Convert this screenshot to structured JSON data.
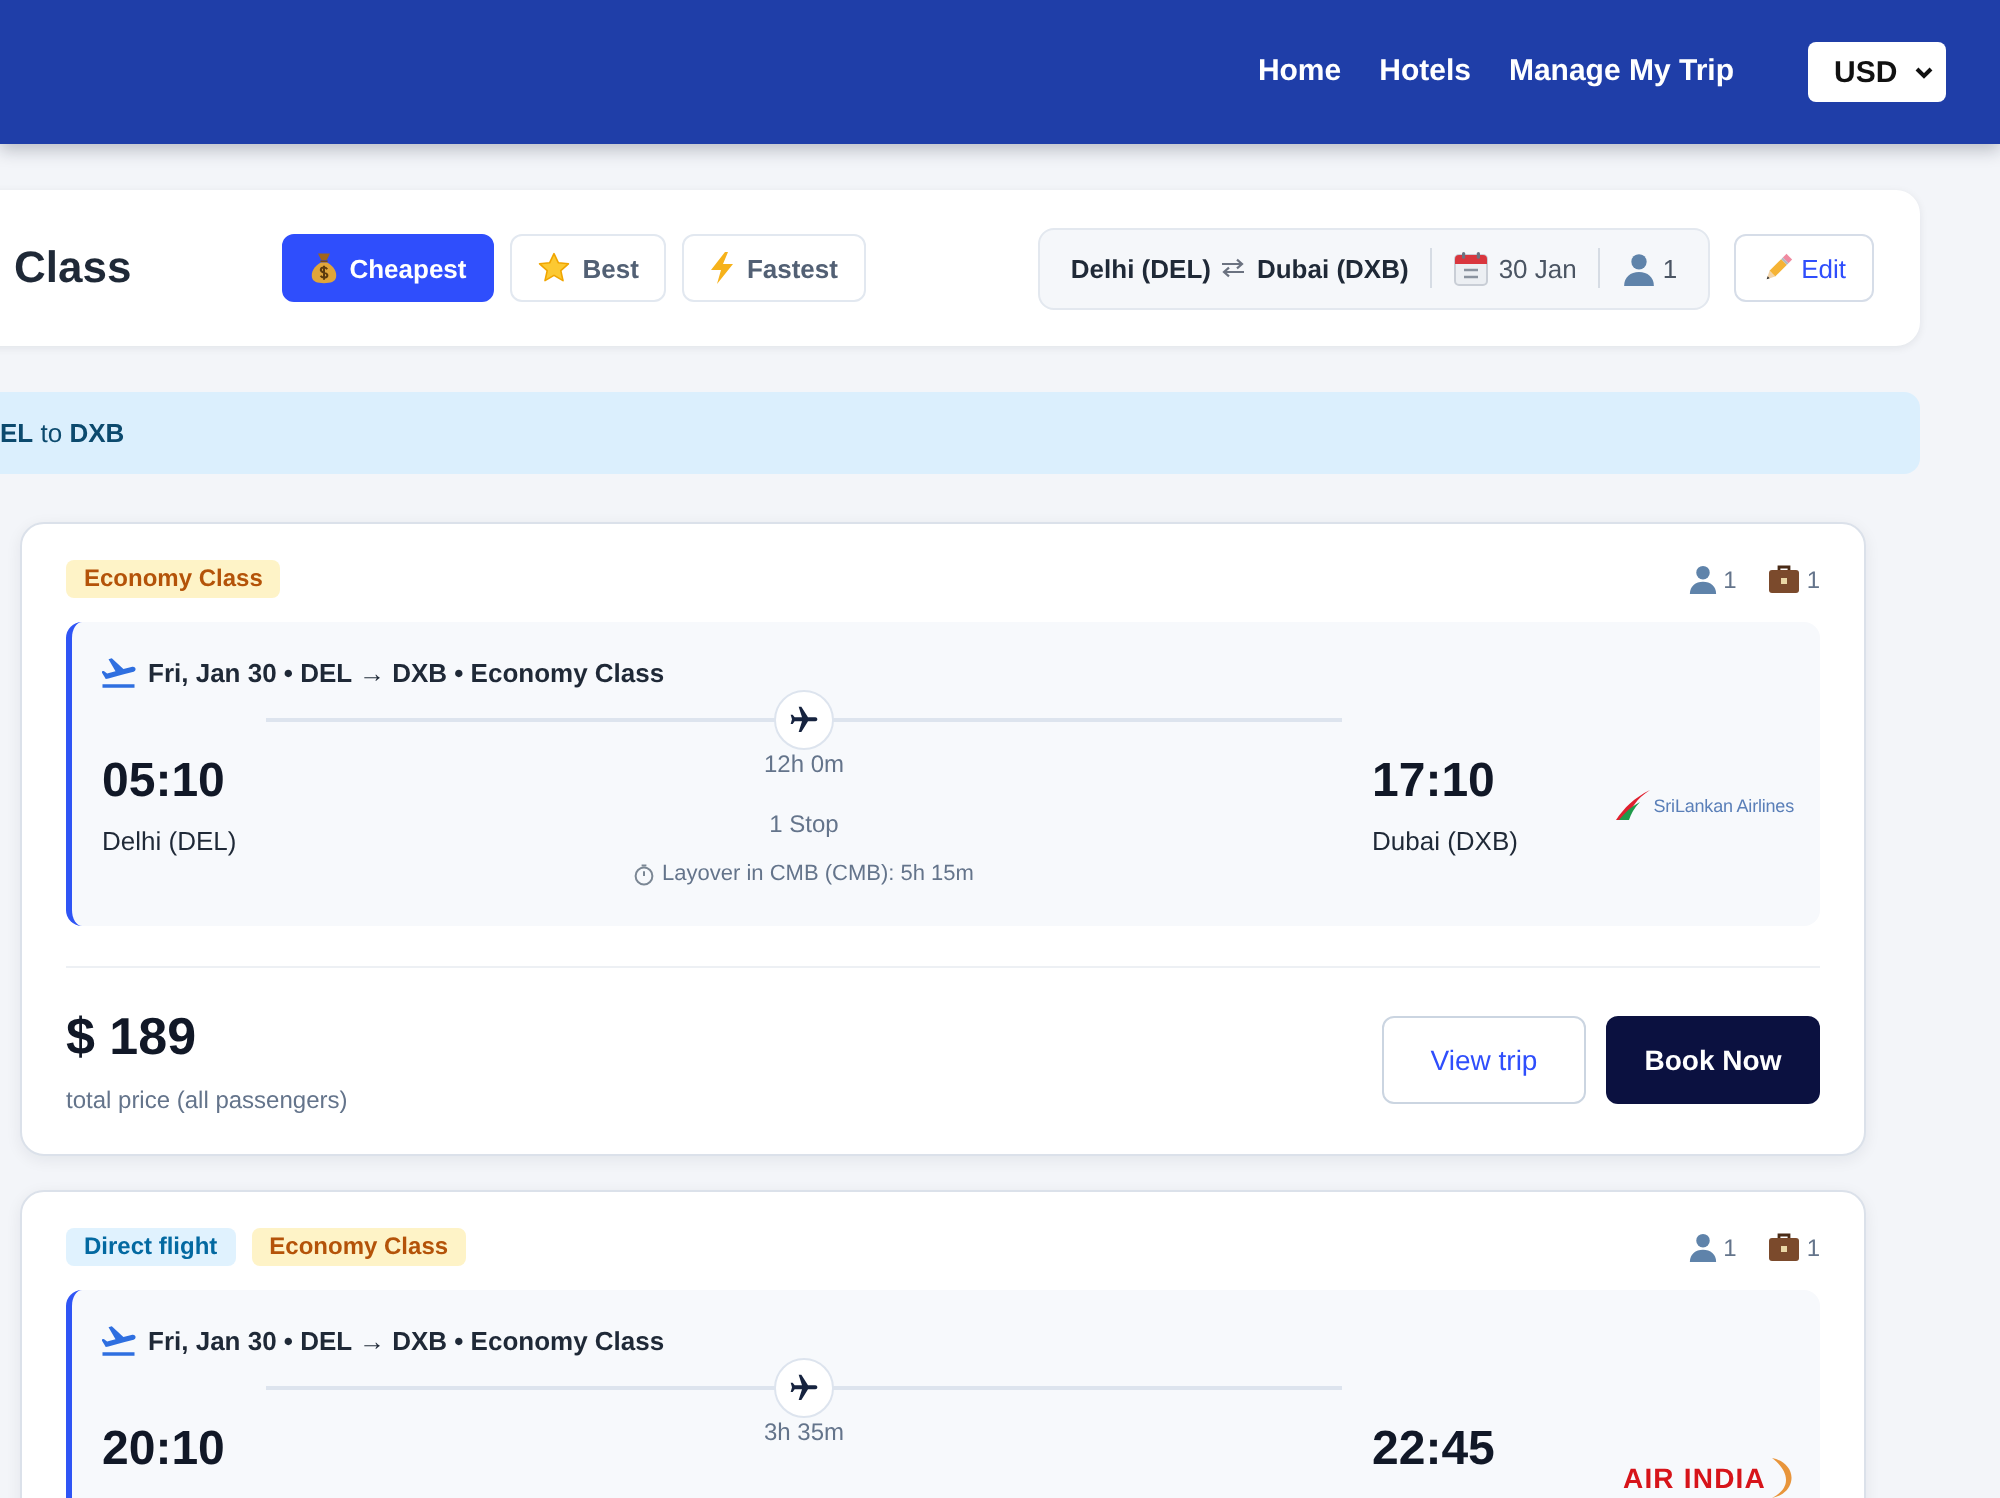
{
  "header": {
    "nav_links": [
      "Home",
      "Hotels",
      "Manage My Trip"
    ],
    "currency": "USD"
  },
  "results_bar": {
    "title": "Class",
    "sort_options": [
      {
        "kind": "price",
        "label": "Cheapest",
        "selected": true
      },
      {
        "kind": "rating",
        "label": "Best",
        "selected": false
      },
      {
        "kind": "speed",
        "label": "Fastest",
        "selected": false
      }
    ],
    "search_summary": {
      "origin": "Delhi (DEL)",
      "destination": "Dubai (DXB)",
      "date": "30 Jan",
      "passengers": "1"
    },
    "edit_button": "Edit"
  },
  "banner": {
    "text": "**EL** to **DXB**"
  },
  "flights": [
    {
      "badges": [
        {
          "kind": "cabin",
          "label": "Economy Class"
        }
      ],
      "passengers": "1",
      "bags": "1",
      "segment": {
        "summary": "Fri, Jan 30 • DEL → DXB • Economy Class",
        "departure_time": "05:10",
        "departure_city": "Delhi (DEL)",
        "duration": "12h 0m",
        "stops": "1 Stop",
        "layover": "Layover in CMB (CMB): 5h 15m",
        "arrival_time": "17:10",
        "arrival_city": "Dubai (DXB)",
        "airline": {
          "kind": "swoosh",
          "name": "SriLankan Airlines"
        }
      },
      "price": "$ 189",
      "price_note": "total price (all passengers)",
      "actions": [
        {
          "kind": "view",
          "label": "View trip"
        },
        {
          "kind": "book",
          "label": "Book Now"
        }
      ]
    },
    {
      "badges": [
        {
          "kind": "direct",
          "label": "Direct flight"
        },
        {
          "kind": "cabin",
          "label": "Economy Class"
        }
      ],
      "passengers": "1",
      "bags": "1",
      "segment": {
        "summary": "Fri, Jan 30 • DEL → DXB • Economy Class",
        "departure_time": "20:10",
        "duration": "3h 35m",
        "arrival_time": "22:45",
        "airline": {
          "kind": "wordmark",
          "name": "AIR INDIA"
        }
      }
    }
  ]
}
